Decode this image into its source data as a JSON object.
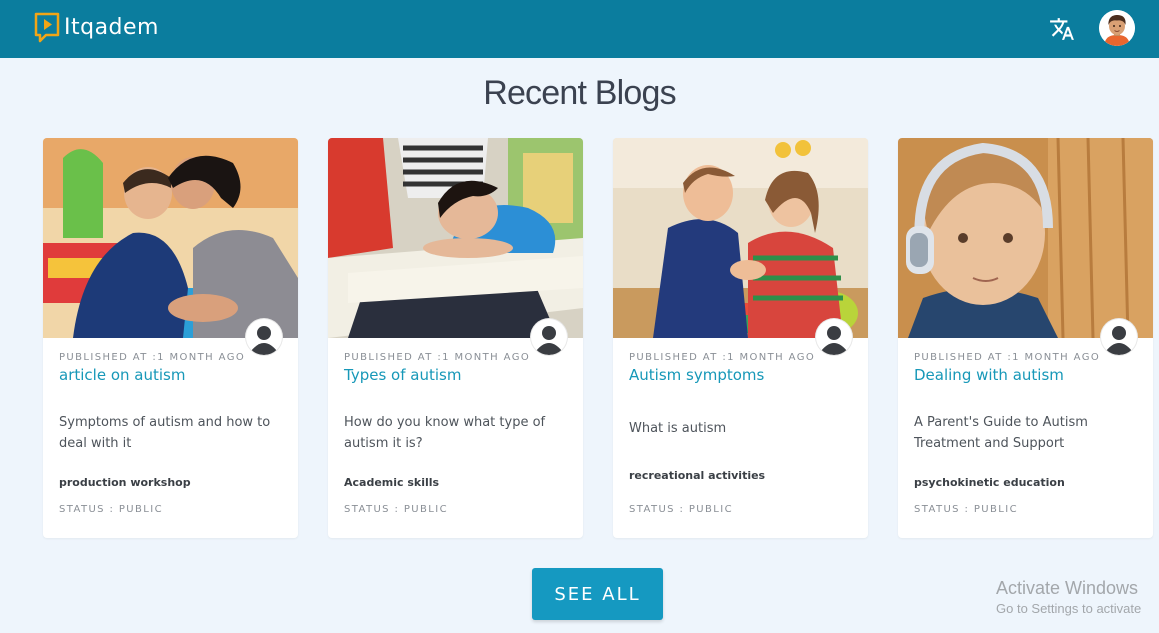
{
  "header": {
    "app_name": "Itqadem",
    "translate_icon": "translate-icon",
    "avatar_icon": "user-avatar-icon",
    "colors": {
      "bar": "#0b7d9e",
      "logo": "#f2a516"
    }
  },
  "main": {
    "title": "Recent Blogs",
    "cards": [
      {
        "meta": "PUBLISHED AT :1 MONTH AGO",
        "title": "article on autism",
        "description": "Symptoms of autism and how to deal with it",
        "category": "production workshop",
        "status": "STATUS : PUBLIC"
      },
      {
        "meta": "PUBLISHED AT :1 MONTH AGO",
        "title": "Types of autism",
        "description": "How do you know what type of autism it is?",
        "category": "Academic skills",
        "status": "STATUS : PUBLIC"
      },
      {
        "meta": "PUBLISHED AT :1 MONTH AGO",
        "title": "Autism symptoms",
        "description": "What is autism",
        "category": "recreational activities",
        "status": "STATUS : PUBLIC"
      },
      {
        "meta": "PUBLISHED AT :1 MONTH AGO",
        "title": "Dealing with autism",
        "description": "A Parent's Guide to Autism Treatment and Support",
        "category": "psychokinetic education",
        "status": "STATUS : PUBLIC"
      }
    ],
    "see_all_label": "SEE ALL",
    "accent_color": "#1599c1"
  },
  "watermark": {
    "line1": "Activate Windows",
    "line2": "Go to Settings to activate"
  }
}
